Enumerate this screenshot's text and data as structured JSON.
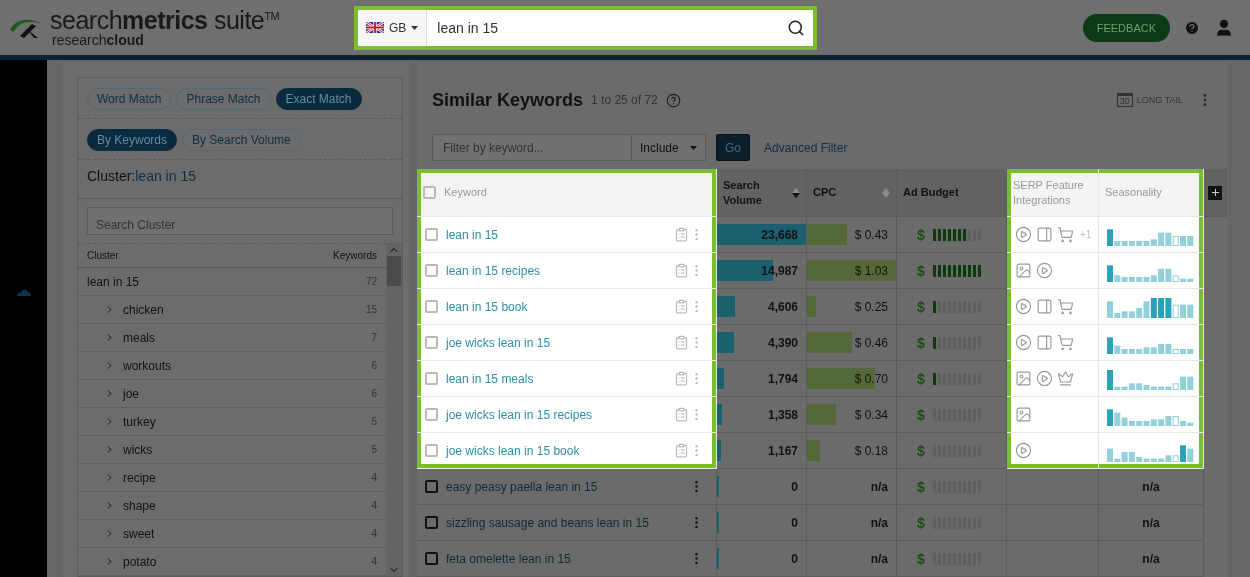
{
  "header": {
    "logo": "search**metrics** suite$^{TM}$",
    "logo_sub": "research**cloud**",
    "search": {
      "country": "GB",
      "value": "lean in 15",
      "highlighted": true
    },
    "feedback": "FEEDBACK"
  },
  "sidebar": {
    "match_modes": [
      {
        "label": "Word Match",
        "selected": false
      },
      {
        "label": "Phrase Match",
        "selected": false
      },
      {
        "label": "Exact Match",
        "selected": true
      }
    ],
    "views": [
      {
        "label": "By Keywords",
        "selected": true
      },
      {
        "label": "By Search Volume",
        "selected": false
      }
    ],
    "cluster_label": "Cluster:",
    "cluster_value": "lean in 15",
    "search_placeholder": "Search Cluster",
    "columns": [
      "Cluster",
      "Keywords"
    ],
    "clusters": [
      {
        "label": "lean in 15",
        "count": "72",
        "children": [
          {
            "label": "chicken",
            "count": "15",
            "expanded": false
          },
          {
            "label": "meals",
            "count": "7",
            "expanded": false
          },
          {
            "label": "workouts",
            "count": "6",
            "expanded": false
          },
          {
            "label": "joe",
            "count": "6",
            "expanded": false
          },
          {
            "label": "turkey",
            "count": "5",
            "expanded": false
          },
          {
            "label": "wicks",
            "count": "5",
            "expanded": false
          },
          {
            "label": "recipe",
            "count": "4",
            "expanded": false
          },
          {
            "label": "shape",
            "count": "4",
            "expanded": false
          },
          {
            "label": "sweet",
            "count": "4",
            "expanded": false
          },
          {
            "label": "potato",
            "count": "4",
            "expanded": false
          }
        ]
      }
    ]
  },
  "main": {
    "title": "Similar Keywords",
    "range": "1 to 25 of 72",
    "long_tail": {
      "day": "30",
      "label": "LONG TAIL"
    },
    "filter": {
      "placeholder": "Filter by keyword...",
      "mode": "Include",
      "go": "Go",
      "advanced": "Advanced Filter"
    },
    "columns": [
      {
        "label": "Keyword",
        "kind": "keyword",
        "highlighted": true,
        "checked": false
      },
      {
        "label": "Search Volume",
        "kind": "volume",
        "highlighted": false,
        "sorted": true
      },
      {
        "label": "CPC",
        "kind": "cpc",
        "highlighted": false,
        "sorted": false
      },
      {
        "label": "Ad Budget",
        "kind": "budget",
        "highlighted": false
      },
      {
        "label": "SERP Feature Integrations",
        "kind": "serp",
        "highlighted": true
      },
      {
        "label": "Seasonality",
        "kind": "season",
        "highlighted": true
      }
    ],
    "spotlight_rows": [
      {
        "keyword": "lean in 15",
        "checked": false,
        "volume": {
          "text": "23,668",
          "level": 1
        },
        "cpc": {
          "text": "$ 0.43",
          "level": 0.45
        },
        "budget": {
          "symbol": "$",
          "level": 0.7
        },
        "serp": [
          {
            "kind": "video"
          },
          {
            "kind": "panel"
          },
          {
            "kind": "cart"
          }
        ],
        "serp_more": "+1"
      },
      {
        "keyword": "lean in 15 recipes",
        "checked": false,
        "volume": {
          "text": "14,987",
          "level": 0.63
        },
        "cpc": {
          "text": "$ 1.03",
          "level": 1
        },
        "budget": {
          "symbol": "$",
          "level": 1
        },
        "serp": [
          {
            "kind": "image"
          },
          {
            "kind": "video"
          }
        ]
      },
      {
        "keyword": "lean in 15 book",
        "checked": false,
        "volume": {
          "text": "4,606",
          "level": 0.2
        },
        "cpc": {
          "text": "$ 0.25",
          "level": 0.1
        },
        "budget": {
          "symbol": "$",
          "level": 0.1
        },
        "serp": [
          {
            "kind": "video"
          },
          {
            "kind": "panel"
          },
          {
            "kind": "cart"
          }
        ]
      },
      {
        "keyword": "joe wicks lean in 15",
        "checked": false,
        "volume": {
          "text": "4,390",
          "level": 0.19
        },
        "cpc": {
          "text": "$ 0.46",
          "level": 0.5
        },
        "budget": {
          "symbol": "$",
          "level": 0.1
        },
        "serp": [
          {
            "kind": "video"
          },
          {
            "kind": "panel"
          },
          {
            "kind": "cart"
          }
        ]
      },
      {
        "keyword": "lean in 15 meals",
        "checked": false,
        "volume": {
          "text": "1,794",
          "level": 0.08
        },
        "cpc": {
          "text": "$ 0.70",
          "level": 0.76
        },
        "budget": {
          "symbol": "$",
          "level": 0.1
        },
        "serp": [
          {
            "kind": "image"
          },
          {
            "kind": "video"
          },
          {
            "kind": "crown"
          }
        ]
      },
      {
        "keyword": "joe wicks lean in 15 recipes",
        "checked": false,
        "volume": {
          "text": "1,358",
          "level": 0.06
        },
        "cpc": {
          "text": "$ 0.34",
          "level": 0.33
        },
        "budget": {
          "symbol": "$",
          "level": 0
        },
        "serp": [
          {
            "kind": "image"
          }
        ]
      },
      {
        "keyword": "joe wicks lean in 15 book",
        "checked": false,
        "volume": {
          "text": "1,167",
          "level": 0.05
        },
        "cpc": {
          "text": "$ 0.18",
          "level": 0.15
        },
        "budget": {
          "symbol": "$",
          "level": 0
        },
        "serp": [
          {
            "kind": "video"
          }
        ]
      }
    ],
    "rows": [
      {
        "keyword": "easy peasy paella lean in 15",
        "checked": false,
        "volume": {
          "text": "0",
          "level": 0.01
        },
        "cpc": {
          "text": "n/a"
        },
        "budget": {
          "symbol": "$",
          "level": 0
        },
        "season": "n/a"
      },
      {
        "keyword": "sizzling sausage and beans lean in 15",
        "checked": false,
        "volume": {
          "text": "0",
          "level": 0.01
        },
        "cpc": {
          "text": "n/a"
        },
        "budget": {
          "symbol": "$",
          "level": 0
        },
        "season": "n/a"
      },
      {
        "keyword": "feta omelette lean in 15",
        "checked": false,
        "volume": {
          "text": "0",
          "level": 0.01
        },
        "cpc": {
          "text": "n/a"
        },
        "budget": {
          "symbol": "$",
          "level": 0
        },
        "season": "n/a"
      }
    ]
  }
}
